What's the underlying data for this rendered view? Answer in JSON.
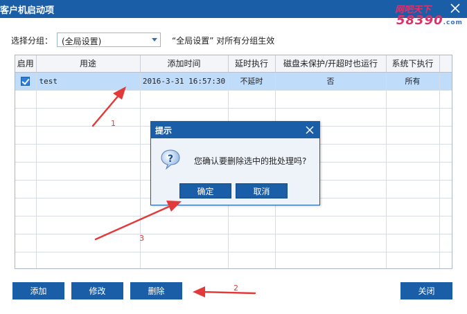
{
  "window": {
    "title": "客户机启动项"
  },
  "watermark": {
    "line1": "网吧天下",
    "line2": "58390",
    "domain": ".com"
  },
  "group": {
    "label": "选择分组：",
    "selected": "(全局设置)",
    "note": "“全局设置” 对所有分组生效"
  },
  "table": {
    "columns": [
      "启用",
      "用途",
      "添加时间",
      "延时执行",
      "磁盘未保护/开超时也运行",
      "系统下执行"
    ],
    "rows": [
      {
        "enabled": true,
        "purpose": "test",
        "added": "2016-3-31 16:57:30",
        "delay": "不延时",
        "run_unprotected": "否",
        "system": "所有"
      }
    ],
    "empty_rows": 10
  },
  "buttons": {
    "add": "添加",
    "edit": "修改",
    "delete": "删除",
    "close": "关闭"
  },
  "dialog": {
    "title": "提示",
    "message": "您确认要删除选中的批处理吗?",
    "ok": "确定",
    "cancel": "取消"
  },
  "annotations": {
    "one": "1",
    "two": "2",
    "three": "3"
  },
  "colors": {
    "accent": "#1b5ea8",
    "selection": "#bfdcfb",
    "annotation": "#e23a3a"
  }
}
